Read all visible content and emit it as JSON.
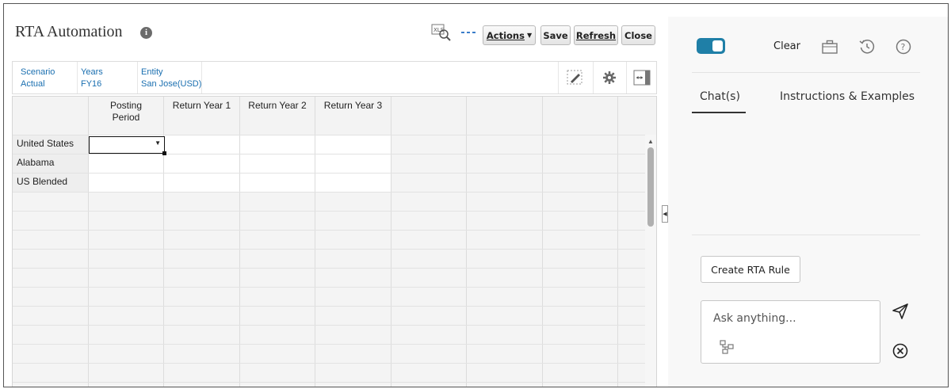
{
  "form": {
    "title": "RTA Automation",
    "toolbar": {
      "actions_label": "Actions",
      "save_label": "Save",
      "refresh_label": "Refresh",
      "close_label": "Close"
    },
    "pov": [
      {
        "dimension": "Scenario",
        "member": "Actual"
      },
      {
        "dimension": "Years",
        "member": "FY16"
      },
      {
        "dimension": "Entity",
        "member": "San Jose(USD)"
      }
    ],
    "grid": {
      "columns": [
        "Posting\nPeriod",
        "Return Year 1",
        "Return Year 2",
        "Return Year 3"
      ],
      "rows": [
        "United States",
        "Alabama",
        "US Blended"
      ]
    }
  },
  "assistant": {
    "clear_label": "Clear",
    "tabs": [
      {
        "label": "Chat(s)",
        "active": true
      },
      {
        "label": "Instructions & Examples",
        "active": false
      }
    ],
    "create_rule_label": "Create RTA Rule",
    "ask_placeholder": "Ask anything..."
  },
  "colors": {
    "accent": "#1f7fa7",
    "link": "#1a6fb0"
  },
  "icons": {
    "title_info": "info-icon",
    "toolbar": [
      "search-xls-icon",
      "more-dots-icon"
    ],
    "pov_tools": [
      "edit-icon",
      "gear-icon",
      "expand-icon"
    ],
    "assistant_header": [
      "briefcase-icon",
      "history-icon",
      "help-icon"
    ],
    "ask": [
      "attach-icon",
      "send-icon",
      "cancel-icon"
    ]
  }
}
